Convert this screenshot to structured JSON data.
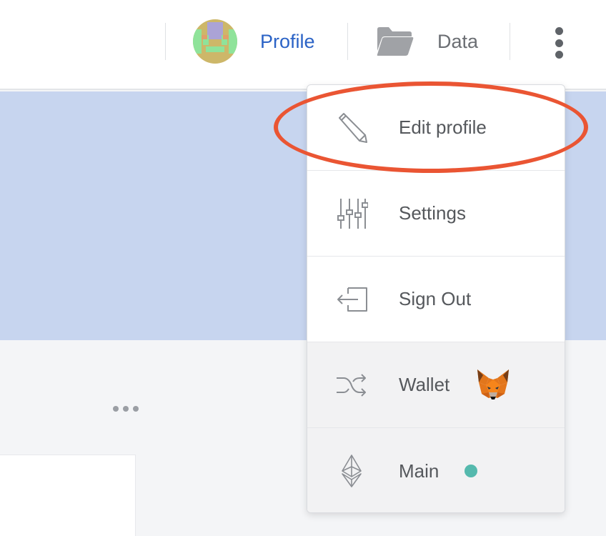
{
  "header": {
    "profile_label": "Profile",
    "data_label": "Data",
    "icons": {
      "avatar": "identicon-avatar",
      "data": "folder-icon",
      "more": "kebab-menu-icon"
    }
  },
  "dropdown": {
    "items": [
      {
        "label": "Edit profile",
        "icon": "pencil-icon"
      },
      {
        "label": "Settings",
        "icon": "sliders-icon"
      },
      {
        "label": "Sign Out",
        "icon": "sign-out-icon"
      },
      {
        "label": "Wallet",
        "icon": "shuffle-icon",
        "badge": "metamask-fox-icon"
      },
      {
        "label": "Main",
        "icon": "ethereum-icon",
        "status_color": "#55b9ad"
      }
    ]
  },
  "colors": {
    "link": "#2b63c6",
    "banner": "#c7d5ef",
    "annotation": "#ea5533"
  }
}
